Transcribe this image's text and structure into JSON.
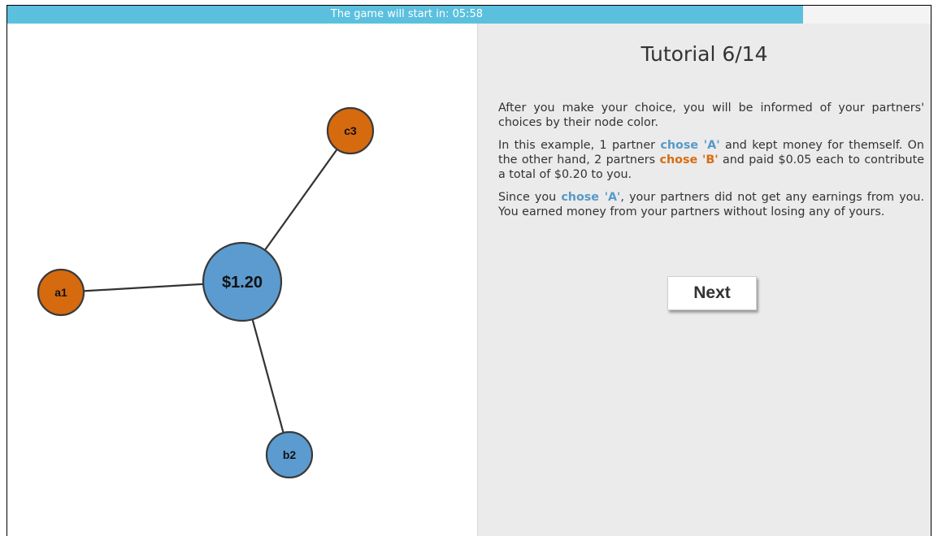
{
  "timer": {
    "label": "The game will start in: 05:58",
    "progress_fraction": 0.862,
    "bar_color": "#5bc0de"
  },
  "graph": {
    "center": {
      "label": "$1.20",
      "color": "#5b9bd0"
    },
    "partners": [
      {
        "id": "a1",
        "label": "a1",
        "choice": "B",
        "color": "#d66a0f"
      },
      {
        "id": "c3",
        "label": "c3",
        "choice": "B",
        "color": "#d66a0f"
      },
      {
        "id": "b2",
        "label": "b2",
        "choice": "A",
        "color": "#5b9bd0"
      }
    ]
  },
  "tutorial": {
    "title": "Tutorial 6/14",
    "p1": "After you make your choice, you will be informed of your partners' choices by their node color.",
    "p2_part1": "In this example, 1 partner ",
    "p2_hl_a": "chose 'A'",
    "p2_part2": " and kept money for themself. On the other hand, 2 partners ",
    "p2_hl_b": "chose 'B'",
    "p2_part3": " and paid $0.05 each to contribute a total of $0.20 to you.",
    "p3_part1": "Since you ",
    "p3_hl_a": "chose 'A'",
    "p3_part2": ", your partners did not get any earnings from you. You earned money from your partners without losing any of yours.",
    "next_label": "Next"
  }
}
